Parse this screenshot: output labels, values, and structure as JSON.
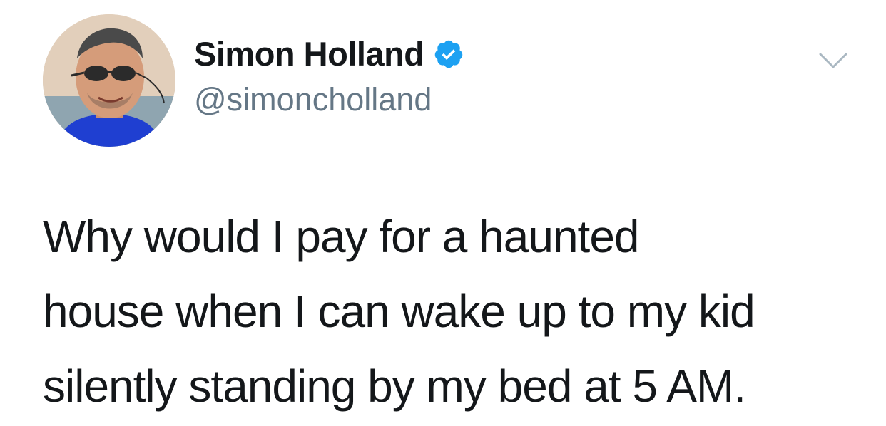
{
  "tweet": {
    "author": {
      "display_name": "Simon Holland",
      "handle": "@simoncholland",
      "verified": true,
      "avatar_icon": "profile-photo"
    },
    "menu_icon": "chevron-down-icon",
    "text": "Why would I pay for a haunted\nhouse when I can wake up to my kid\nsilently standing by my bed at 5 AM."
  },
  "colors": {
    "verified_blue": "#1da1f2",
    "handle_gray": "#657786",
    "text": "#14171a",
    "chevron_gray": "#aab8c2"
  }
}
